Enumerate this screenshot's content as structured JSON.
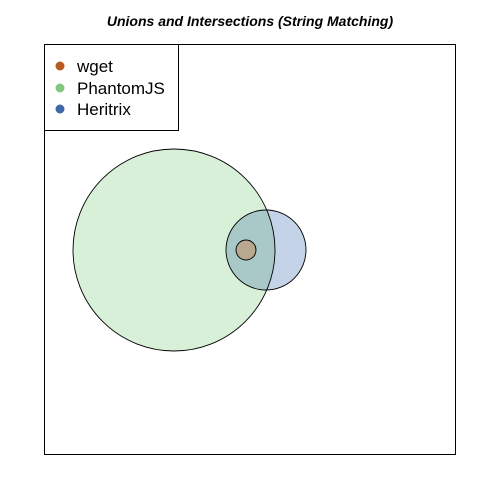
{
  "chart_data": {
    "type": "venn",
    "title": "Unions and Intersections (String Matching)",
    "legend_position": "top-left",
    "sets": [
      {
        "name": "wget",
        "color": "#B85A1F",
        "fill": "#B8A890"
      },
      {
        "name": "PhantomJS",
        "color": "#82C77F",
        "fill": "#D8EFD8"
      },
      {
        "name": "Heritrix",
        "color": "#3F68A8",
        "fill": "#C4D3E8"
      }
    ],
    "intersection_fill": "#A9C8C8"
  }
}
